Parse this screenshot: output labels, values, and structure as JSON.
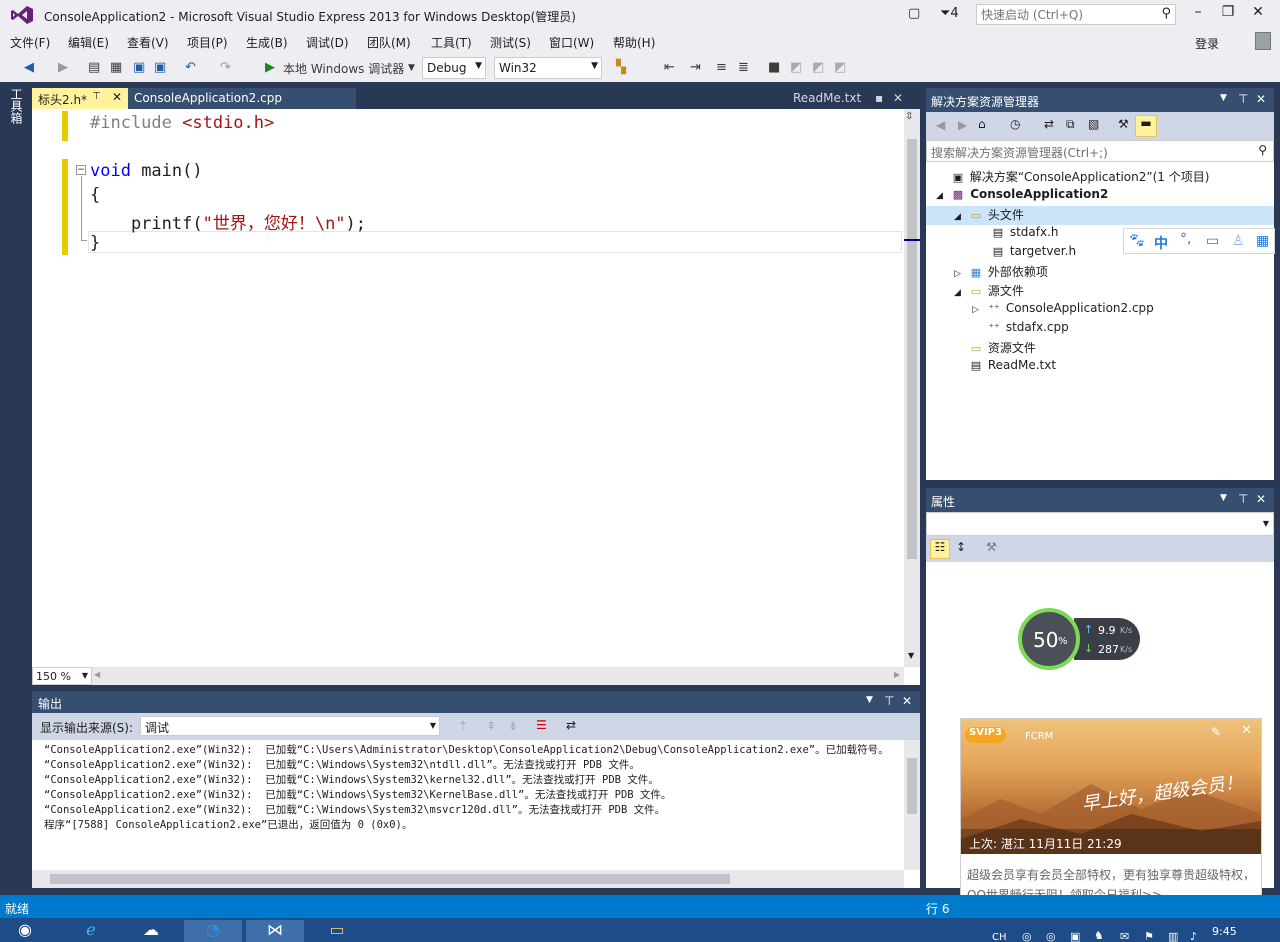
{
  "window": {
    "title": "ConsoleApplication2 - Microsoft Visual Studio Express 2013 for Windows Desktop(管理员)",
    "notification_count": "4",
    "quick_launch_placeholder": "快速启动 (Ctrl+Q)",
    "signin": "登录"
  },
  "menu": [
    "文件(F)",
    "编辑(E)",
    "查看(V)",
    "项目(P)",
    "生成(B)",
    "调试(D)",
    "团队(M)",
    "工具(T)",
    "测试(S)",
    "窗口(W)",
    "帮助(H)"
  ],
  "toolbar": {
    "debug_target": "本地 Windows 调试器",
    "configuration": "Debug",
    "platform": "Win32"
  },
  "toolbox_label": "工具箱",
  "editor": {
    "tabs": [
      {
        "label": "标头2.h*"
      },
      {
        "label": "ConsoleApplication2.cpp"
      }
    ],
    "preview_tab": "ReadMe.txt",
    "code": {
      "line1_directive": "#include",
      "line1_header": " <stdio.h>",
      "line3_kw": "void",
      "line3_rest": " main()",
      "line4": "{",
      "line5_fn": "    printf(",
      "line5_str": "\"世界，您好！\\n\"",
      "line5_end": ");",
      "line6": "}"
    },
    "zoom": "150 %"
  },
  "output": {
    "title": "输出",
    "source_label": "显示输出来源(S):",
    "source_value": "调试",
    "lines": [
      "“ConsoleApplication2.exe”(Win32):  已加载“C:\\Users\\Administrator\\Desktop\\ConsoleApplication2\\Debug\\ConsoleApplication2.exe”。已加载符号。",
      "“ConsoleApplication2.exe”(Win32):  已加载“C:\\Windows\\System32\\ntdll.dll”。无法查找或打开 PDB 文件。",
      "“ConsoleApplication2.exe”(Win32):  已加载“C:\\Windows\\System32\\kernel32.dll”。无法查找或打开 PDB 文件。",
      "“ConsoleApplication2.exe”(Win32):  已加载“C:\\Windows\\System32\\KernelBase.dll”。无法查找或打开 PDB 文件。",
      "“ConsoleApplication2.exe”(Win32):  已加载“C:\\Windows\\System32\\msvcr120d.dll”。无法查找或打开 PDB 文件。",
      "程序“[7588] ConsoleApplication2.exe”已退出，返回值为 0 (0x0)。"
    ]
  },
  "solution_explorer": {
    "title": "解决方案资源管理器",
    "search_placeholder": "搜索解决方案资源管理器(Ctrl+;)",
    "solution": "解决方案“ConsoleApplication2”(1 个项目)",
    "project": "ConsoleApplication2",
    "headers_folder": "头文件",
    "headers": [
      "stdafx.h",
      "targetver.h"
    ],
    "external": "外部依赖项",
    "sources_folder": "源文件",
    "sources": [
      "ConsoleApplication2.cpp",
      "stdafx.cpp"
    ],
    "resources_folder": "资源文件",
    "readme": "ReadMe.txt"
  },
  "ime": {
    "lang": "中",
    "punct": "°,"
  },
  "properties": {
    "title": "属性"
  },
  "net_meter": {
    "percent": "50",
    "unit": "%",
    "up": "9.9",
    "down": "287",
    "rate_unit": "K/s"
  },
  "qq_popup": {
    "badge": "SVIP3",
    "sub": "FCRM",
    "greeting": "早上好，超级会员！",
    "last_login": "上次: 湛江  11月11日 21:29",
    "message": "超级会员享有会员全部特权，更有独享尊贵超级特权，QQ世界畅行无阻！领取今日福利>>"
  },
  "status": {
    "ready": "就绪",
    "line": "行 6"
  },
  "taskbar": {
    "lang": "CH",
    "time": "9:45"
  },
  "colors": {
    "accent": "#007acc",
    "panel_header": "#364e6f",
    "active_tab": "#fff29d",
    "background": "#293955"
  }
}
